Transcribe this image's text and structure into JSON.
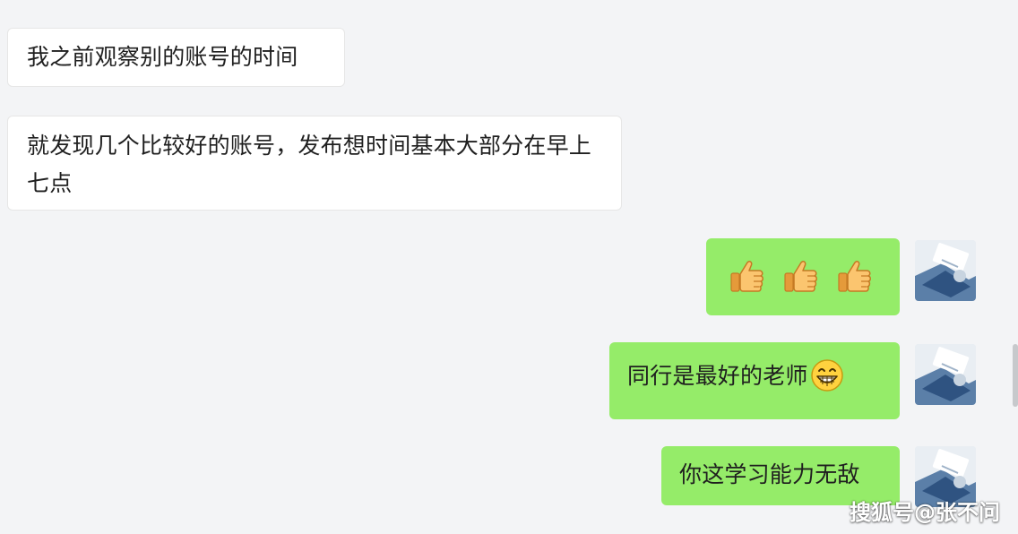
{
  "chat": {
    "messages": [
      {
        "side": "incoming",
        "text": "我之前观察别的账号的时间"
      },
      {
        "side": "incoming",
        "text": "就发现几个比较好的账号，发布想时间基本大部分在早上七点"
      },
      {
        "side": "outgoing",
        "emoji": [
          "thumbs-up",
          "thumbs-up",
          "thumbs-up"
        ]
      },
      {
        "side": "outgoing",
        "text": "同行是最好的老师",
        "emoji": [
          "grinning-face"
        ]
      },
      {
        "side": "outgoing",
        "text": "你这学习能力无敌"
      }
    ]
  },
  "watermark": "搜狐号@张不问",
  "colors": {
    "background": "#f3f4f6",
    "incoming_bubble": "#ffffff",
    "outgoing_bubble": "#95ec69",
    "text": "#1f1f1f"
  }
}
